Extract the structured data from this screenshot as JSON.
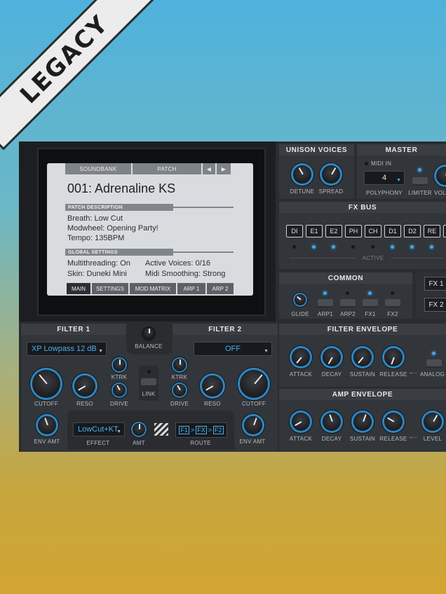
{
  "banner": "LEGACY",
  "screen": {
    "tabs": [
      "SOUNDBANK",
      "PATCH"
    ],
    "patch_name": "001: Adrenaline KS",
    "desc_header": "PATCH DESCRIPTION",
    "desc_lines": [
      "Breath: Low Cut",
      "Modwheel: Opening Party!",
      "Tempo: 135BPM"
    ],
    "global_header": "GLOBAL SETTINGS",
    "global_left": [
      "Multithreading: On",
      "Skin: Duneki Mini"
    ],
    "global_right": [
      "Active Voices: 0/16",
      "Midi Smoothing: Strong"
    ],
    "bottom_tabs": [
      "MAIN",
      "SETTINGS",
      "MOD MATRIX",
      "ARP 1",
      "ARP 2"
    ]
  },
  "unison": {
    "title": "UNISON VOICES",
    "detune": "DETUNE",
    "spread": "SPREAD"
  },
  "master": {
    "title": "MASTER",
    "midi_in": "MIDI IN",
    "polyphony_value": "4",
    "polyphony": "POLYPHONY",
    "limiter": "LIMITER",
    "volume": "VOLU"
  },
  "fxbus": {
    "title": "FX BUS",
    "buttons": [
      "DI",
      "E1",
      "E2",
      "PH",
      "CH",
      "D1",
      "D2",
      "RE"
    ],
    "active": "ACTIVE"
  },
  "common": {
    "title": "COMMON",
    "glide": "GLIDE",
    "arp1": "ARP1",
    "arp2": "ARP2",
    "fx1": "FX1",
    "fx2": "FX2",
    "fx1_btn": "FX 1",
    "fx2_btn": "FX 2"
  },
  "filter1": {
    "title": "FILTER 1",
    "type": "XP Lowpass 12 dB",
    "ktrk": "KTRK",
    "cutoff": "CUTOFF",
    "reso": "RESO",
    "drive": "DRIVE",
    "env_amt": "ENV AMT"
  },
  "filter2": {
    "title": "FILTER 2",
    "type": "OFF",
    "ktrk": "KTRK",
    "cutoff": "CUTOFF",
    "reso": "RESO",
    "drive": "DRIVE",
    "env_amt": "ENV AMT"
  },
  "balance": "BALANCE",
  "link": "LINK",
  "effect": {
    "value": "LowCut+KT",
    "label": "EFFECT",
    "amt": "AMT"
  },
  "route": {
    "f1": "F1",
    "fx": "FX",
    "f2": "F2",
    "label": "ROUTE"
  },
  "filter_env": {
    "title": "FILTER ENVELOPE",
    "attack": "ATTACK",
    "decay": "DECAY",
    "sustain": "SUSTAIN",
    "release": "RELEASE",
    "analog": "ANALOG"
  },
  "amp_env": {
    "title": "AMP ENVELOPE",
    "attack": "ATTACK",
    "decay": "DECAY",
    "sustain": "SUSTAIN",
    "release": "RELEASE",
    "level": "LEVEL"
  }
}
